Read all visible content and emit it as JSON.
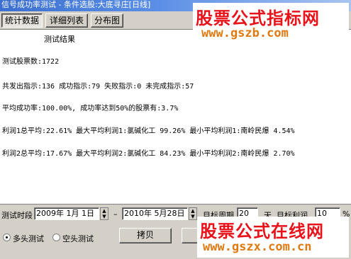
{
  "window": {
    "title": "信号成功率测试 - 条件选股:大底寻庄[日线]"
  },
  "tabs": [
    {
      "label": "统计数据"
    },
    {
      "label": "详细列表"
    },
    {
      "label": "分布图"
    }
  ],
  "results": {
    "heading": "测试结果",
    "lines": [
      "测试股票数:1722",
      "共发出指示:136 成功指示:79 失败指示:0 未完成指示:57",
      "平均成功率:100.00%, 成功率达到50%的股票有:3.7%",
      "利润1总平均:22.61% 最大平均利润1:氯碱化工 99.26% 最小平均利润1:南岭民爆 4.54%",
      "利润2总平均:17.67% 最大平均利润2:氯碱化工 84.23% 最小平均利润2:南岭民爆 2.70%"
    ]
  },
  "bottom": {
    "period_label": "测试时段",
    "start_date": "2009年 1月 1日",
    "dash": "–",
    "end_date": "2010年 5月28日",
    "target_period_label": "目标周期",
    "target_period_value": "20",
    "days_label": "天",
    "target_profit_label": "目标利润",
    "target_profit_value": "10",
    "percent": "%",
    "radio_long": "多头测试",
    "radio_short": "空头测试",
    "copy_button": "拷贝"
  },
  "watermarks": {
    "top_title": "股票公式指标网",
    "top_url": "www.gszb.com",
    "bottom_title": "股票公式在线网",
    "bottom_url": "www.gszx.com.cn"
  },
  "colors": {
    "titlebar": "#3a6fd0",
    "panel": "#d4d0c8",
    "watermark_red": "#e8121a",
    "watermark_orange": "#e07a10"
  }
}
